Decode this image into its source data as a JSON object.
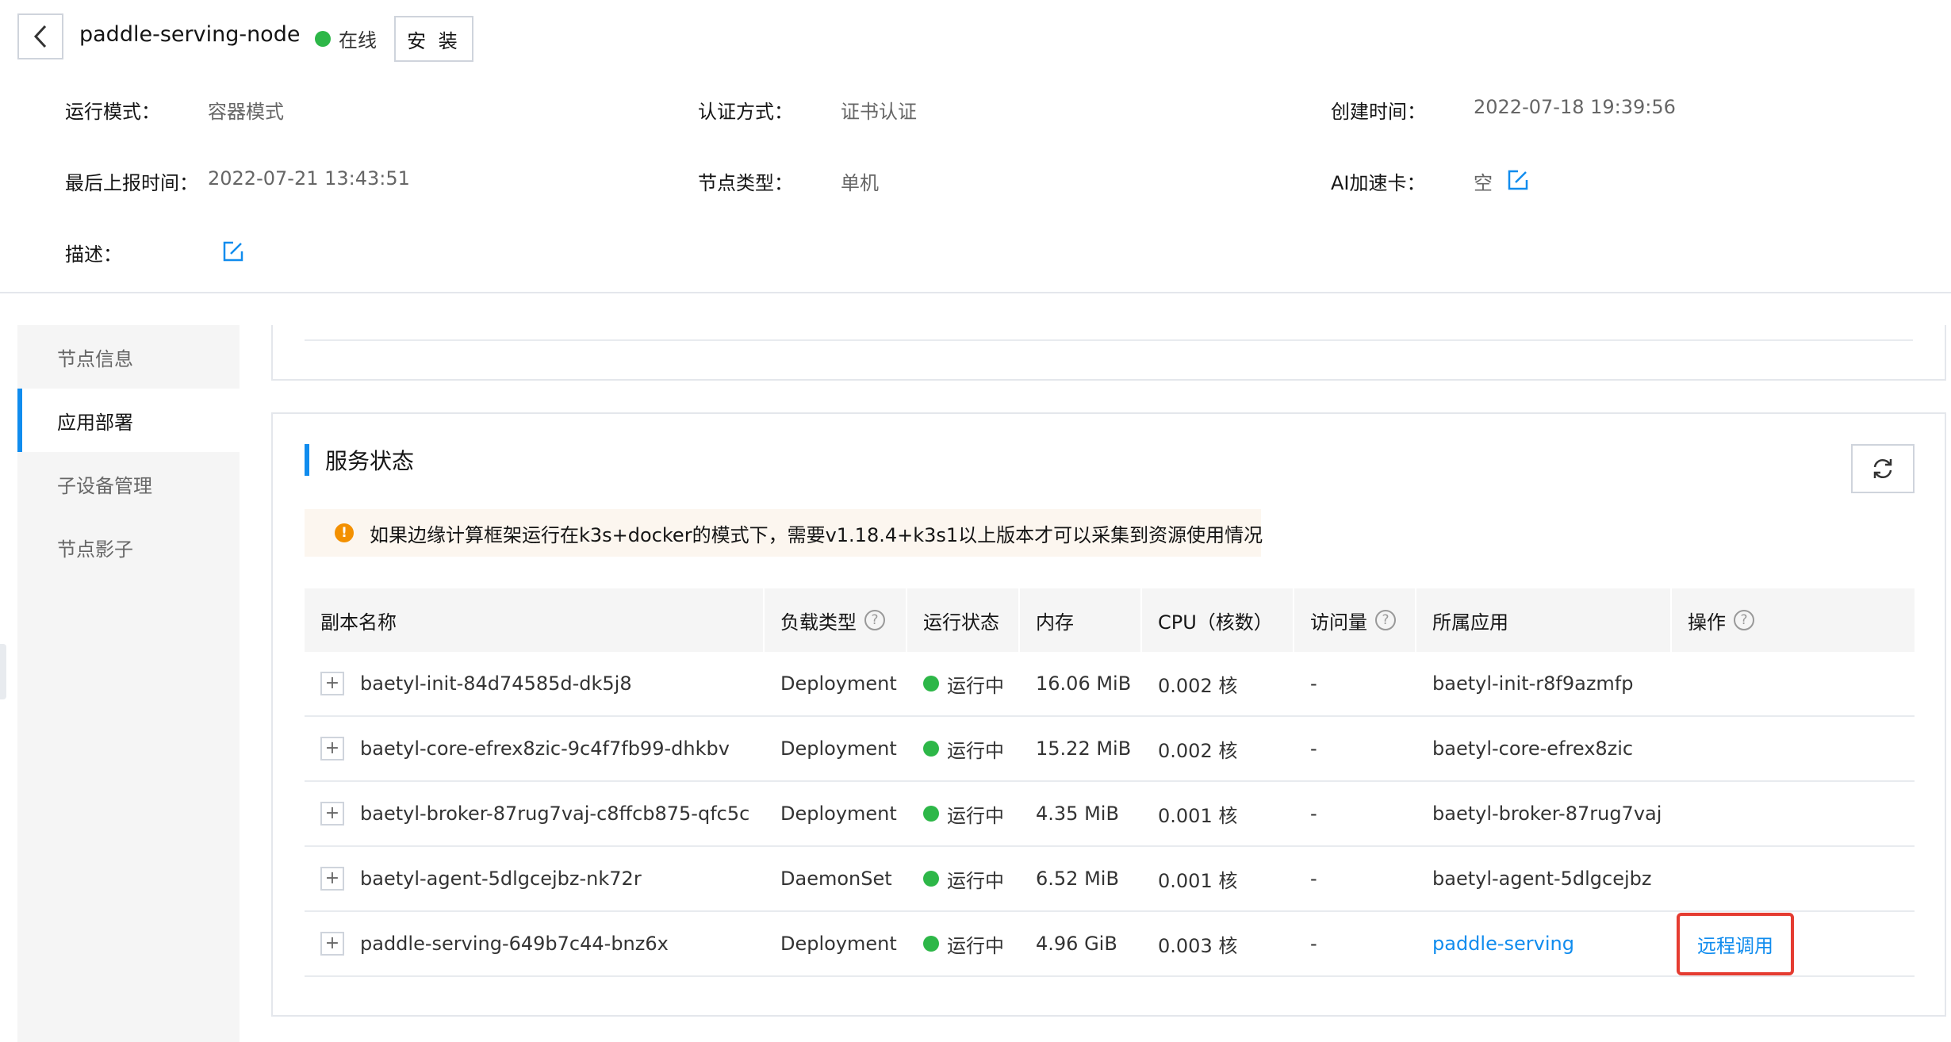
{
  "header": {
    "node_name": "paddle-serving-node",
    "status": "在线",
    "status_color": "#2db748",
    "install_label": "安 装"
  },
  "info": {
    "run_mode_label": "运行模式：",
    "run_mode_value": "容器模式",
    "auth_label": "认证方式：",
    "auth_value": "证书认证",
    "created_label": "创建时间：",
    "created_value": "2022-07-18 19:39:56",
    "last_report_label": "最后上报时间：",
    "last_report_value": "2022-07-21 13:43:51",
    "node_type_label": "节点类型：",
    "node_type_value": "单机",
    "ai_card_label": "AI加速卡：",
    "ai_card_value": "空",
    "desc_label": "描述："
  },
  "sidebar": {
    "items": [
      {
        "label": "节点信息"
      },
      {
        "label": "应用部署"
      },
      {
        "label": "子设备管理"
      },
      {
        "label": "节点影子"
      }
    ],
    "active_index": 1
  },
  "service": {
    "title": "服务状态",
    "notice": "如果边缘计算框架运行在k3s+docker的模式下，需要v1.18.4+k3s1以上版本才可以采集到资源使用情况",
    "notice_icon": "!",
    "columns": [
      "副本名称",
      "负载类型",
      "运行状态",
      "内存",
      "CPU（核数）",
      "访问量",
      "所属应用",
      "操作"
    ],
    "help_icon": "?",
    "expand_symbol": "+",
    "rows": [
      {
        "name": "baetyl-init-84d74585d-dk5j8",
        "type": "Deployment",
        "status": "运行中",
        "memory": "16.06 MiB",
        "cpu": "0.002 核",
        "visits": "-",
        "app": "baetyl-init-r8f9azmfp",
        "action": ""
      },
      {
        "name": "baetyl-core-efrex8zic-9c4f7fb99-dhkbv",
        "type": "Deployment",
        "status": "运行中",
        "memory": "15.22 MiB",
        "cpu": "0.002 核",
        "visits": "-",
        "app": "baetyl-core-efrex8zic",
        "action": ""
      },
      {
        "name": "baetyl-broker-87rug7vaj-c8ffcb875-qfc5c",
        "type": "Deployment",
        "status": "运行中",
        "memory": "4.35 MiB",
        "cpu": "0.001 核",
        "visits": "-",
        "app": "baetyl-broker-87rug7vaj",
        "action": ""
      },
      {
        "name": "baetyl-agent-5dlgcejbz-nk72r",
        "type": "DaemonSet",
        "status": "运行中",
        "memory": "6.52 MiB",
        "cpu": "0.001 核",
        "visits": "-",
        "app": "baetyl-agent-5dlgcejbz",
        "action": ""
      },
      {
        "name": "paddle-serving-649b7c44-bnz6x",
        "type": "Deployment",
        "status": "运行中",
        "memory": "4.96 GiB",
        "cpu": "0.003 核",
        "visits": "-",
        "app": "paddle-serving",
        "action": "远程调用"
      }
    ]
  }
}
